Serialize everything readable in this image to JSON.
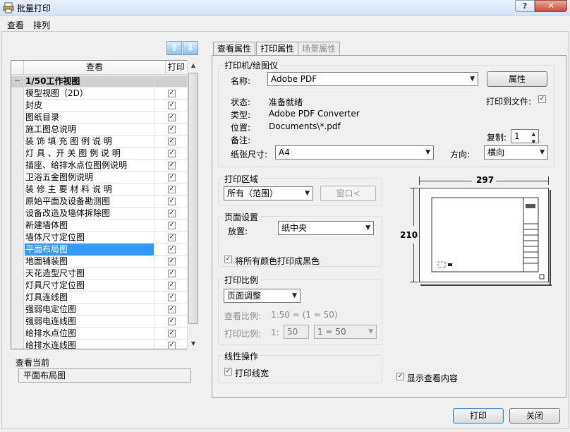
{
  "window": {
    "title": "批量打印",
    "help_label": "?",
    "close_label": "✕"
  },
  "menu": [
    "查看",
    "排列"
  ],
  "icons": {
    "up": "up-arrow-icon",
    "down": "down-arrow-icon"
  },
  "list": {
    "col_view": "查看",
    "col_print": "打印",
    "group_marker": "--",
    "group_label": "1/50工作视图",
    "items": [
      "模型视图（2D）",
      "封皮",
      "图纸目录",
      "施工图总说明",
      "装 饰 填 充 图 例 说 明",
      "灯 具 、开 关 图 例 说 明",
      "插座、给排水点位图例说明",
      "卫浴五金图例说明",
      "装 修 主 要 材 料 说 明",
      "原始平面及设备勘测图",
      "设备改造及墙体拆除图",
      "新建墙体图",
      "墙体尺寸定位图",
      "平面布局图",
      "地面铺装图",
      "天花造型尺寸图",
      "灯具尺寸定位图",
      "灯具连线图",
      "强弱电定位图",
      "强弱电连线图",
      "给排水点位图",
      "给排水连线图"
    ],
    "selected_index": 13,
    "checkmark": "✓"
  },
  "current_view": {
    "title": "查看当前",
    "value": "平面布局图"
  },
  "tabs": [
    "查看属性",
    "打印属性",
    "场景属性"
  ],
  "printer": {
    "group_title": "打印机/绘图仪",
    "name_label": "名称:",
    "name_value": "Adobe PDF",
    "props_button": "属性",
    "status_label": "状态:",
    "status_value": "准备就绪",
    "type_label": "类型:",
    "type_value": "Adobe PDF Converter",
    "location_label": "位置:",
    "location_value": "Documents\\*.pdf",
    "comment_label": "备注:",
    "print_to_file_label": "打印到文件:",
    "copies_label": "复制:",
    "copies_value": "1",
    "paper_label": "纸张尺寸:",
    "paper_value": "A4",
    "orient_label": "方向:",
    "orient_value": "横向"
  },
  "area": {
    "title": "打印区域",
    "value": "所有（范围）",
    "window_button": "窗口<"
  },
  "page": {
    "title": "页面设置",
    "place_label": "放置:",
    "place_value": "纸中央",
    "bw_label": "将所有颜色打印成黑色"
  },
  "scale": {
    "title": "打印比例",
    "mode_value": "页面调整",
    "view_scale_label": "查看比例:",
    "view_scale_value": "1:50 = (1 = 50)",
    "print_scale_label": "打印比例:",
    "print_scale_prefix": "1:",
    "print_scale_num": "50",
    "print_scale_combo": "1 = 50"
  },
  "lineops": {
    "title": "线性操作",
    "linewidth_label": "打印线宽"
  },
  "preview": {
    "width_label": "297",
    "height_label": "210"
  },
  "show_content_label": "显示查看内容",
  "buttons": {
    "print": "打印",
    "close": "关闭"
  }
}
